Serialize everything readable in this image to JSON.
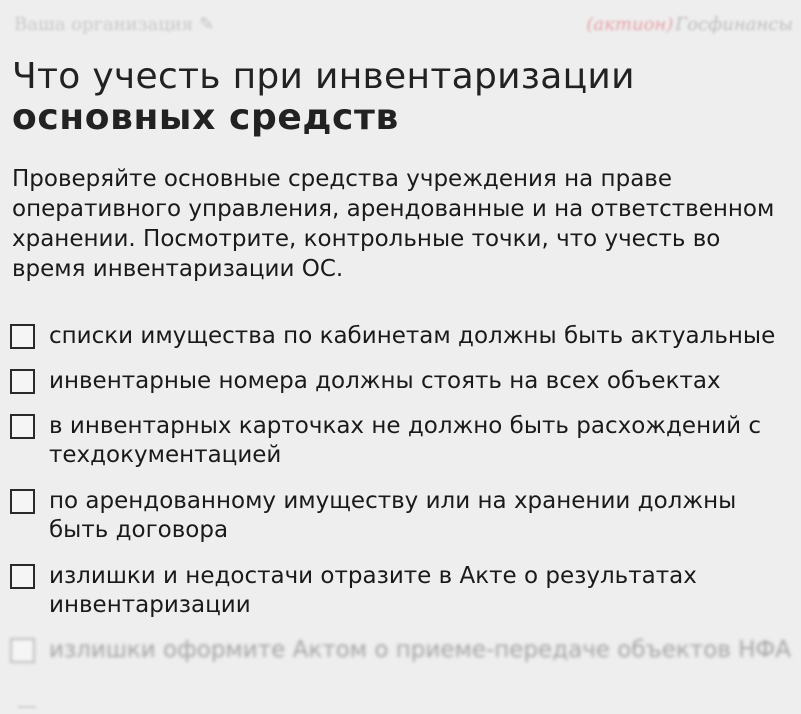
{
  "header": {
    "organization_placeholder": "Ваша организация",
    "brand_left": "(актион)",
    "brand_right": "Госфинансы"
  },
  "title": {
    "line1": "Что учесть при инвентаризации",
    "line2": "основных средств"
  },
  "intro": "Проверяйте основные средства учреждения на праве оперативного управления, арендованные и на ответственном хранении. Посмотрите, контрольные точки,  что учесть во время инвентаризации ОС.",
  "checklist": [
    {
      "text": "списки имущества по кабинетам должны быть актуальные",
      "checked": false
    },
    {
      "text": "инвентарные номера должны стоять на всех объектах",
      "checked": false
    },
    {
      "text": "в инвентарных карточках не должно быть расхождений с техдокументацией",
      "checked": false
    },
    {
      "text": "по арендованному имуществу или на хранении должны быть договора",
      "checked": false
    },
    {
      "text": "излишки и недостачи  отразите в Акте о результатах инвентаризации",
      "checked": false
    },
    {
      "text": "излишки оформите Актом о приеме-передаче объектов НФА",
      "checked": false
    }
  ]
}
